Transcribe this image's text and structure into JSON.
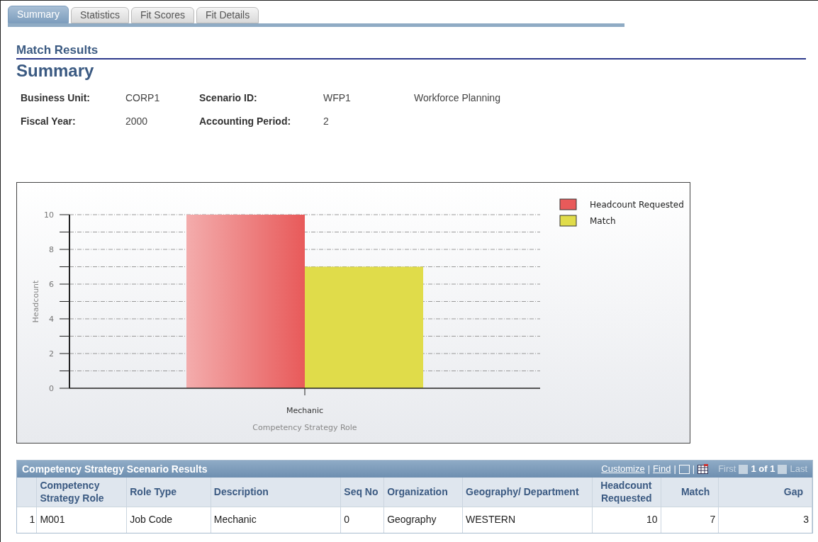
{
  "tabs": [
    {
      "label": "Summary",
      "selected": true
    },
    {
      "label": "Statistics",
      "selected": false
    },
    {
      "label": "Fit Scores",
      "selected": false
    },
    {
      "label": "Fit Details",
      "selected": false
    }
  ],
  "page_group": "Match Results",
  "page_title": "Summary",
  "fields": [
    {
      "label": "Business Unit:",
      "value": "CORP1"
    },
    {
      "label": "Scenario ID:",
      "value": "WFP1",
      "description": "Workforce Planning"
    },
    {
      "label": "Fiscal Year:",
      "value": "2000"
    },
    {
      "label": "Accounting Period:",
      "value": "2"
    }
  ],
  "chart": {
    "chart_data": {
      "type": "bar",
      "xlabel": "Competency Strategy Role",
      "ylabel": "Headcount",
      "categories": [
        "Mechanic"
      ],
      "series": [
        {
          "name": "Headcount Requested",
          "color": "#e85a5a",
          "values": [
            10
          ]
        },
        {
          "name": "Match",
          "color": "#e0dc4a",
          "values": [
            7
          ]
        }
      ],
      "ylim": [
        0,
        10
      ],
      "yticks": [
        0,
        2,
        4,
        6,
        8,
        10
      ],
      "grid": true,
      "legend": "right"
    }
  },
  "grid": {
    "title": "Competency Strategy Scenario Results",
    "links": [
      "Customize",
      "Find"
    ],
    "separators": [
      "|",
      "|",
      "|"
    ],
    "nav": {
      "first": "First",
      "range": "1 of 1",
      "last": "Last"
    },
    "columns": [
      {
        "label": "Competency Strategy Role"
      },
      {
        "label": "Role Type"
      },
      {
        "label": "Description"
      },
      {
        "label": "Seq No"
      },
      {
        "label": "Organization"
      },
      {
        "label": "Geography/ Department"
      },
      {
        "label": "Headcount Requested"
      },
      {
        "label": "Match"
      },
      {
        "label": "Gap"
      }
    ],
    "rows": [
      {
        "number": "1",
        "cells": [
          "M001",
          "Job Code",
          "Mechanic",
          "0",
          "Geography",
          "WESTERN",
          "10",
          "7",
          "3"
        ]
      }
    ]
  }
}
